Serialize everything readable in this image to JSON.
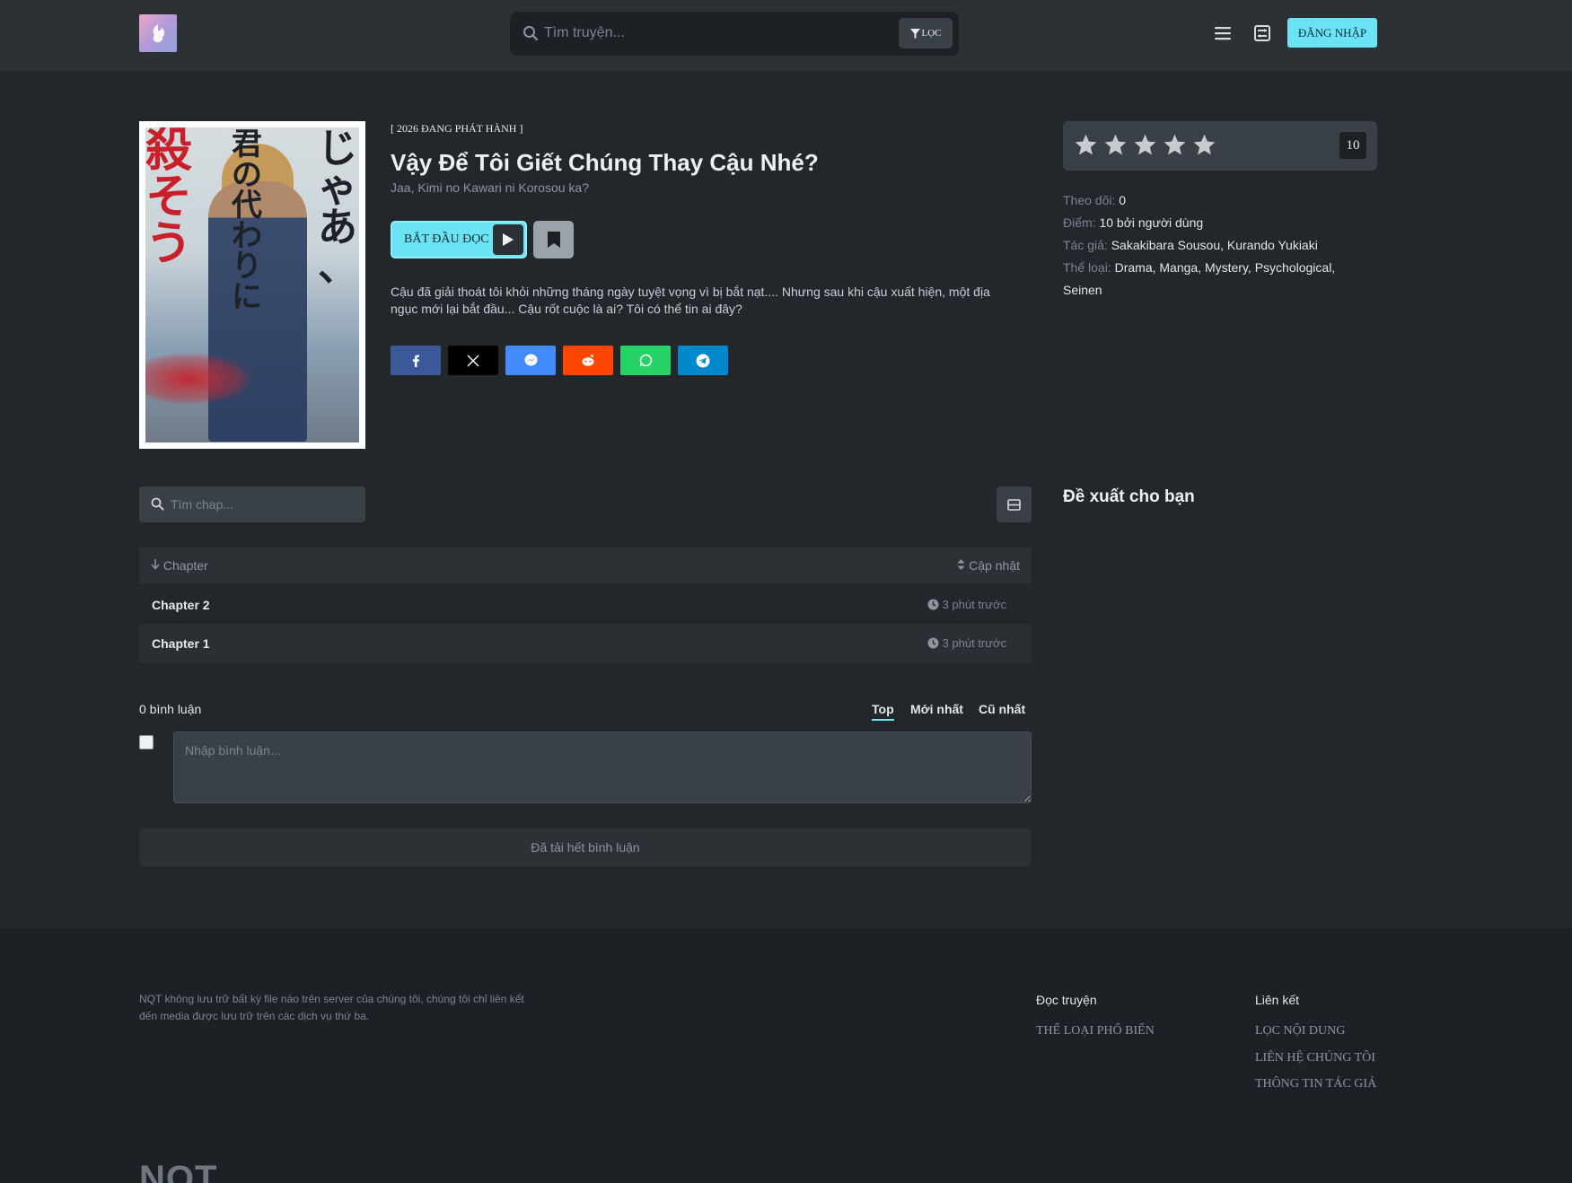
{
  "header": {
    "search_placeholder": "Tìm truyện...",
    "filter_label": "LỌC",
    "login_label": "ĐĂNG NHẬP"
  },
  "manga": {
    "status": "[ 2026 ĐANG PHÁT HÀNH ]",
    "title": "Vậy Để Tôi Giết Chúng Thay Cậu Nhé?",
    "alt_title": "Jaa, Kimi no Kawari ni Korosou ka?",
    "read_label": "BẮT ĐẦU ĐỌC",
    "description": "Cậu đã giải thoát tôi khỏi những tháng ngày tuyệt vọng vì bị bắt nạt.... Nhưng sau khi cậu xuất hiện, một địa ngục mới lại bắt đầu... Cậu rốt cuộc là ai? Tôi có thể tin ai đây?"
  },
  "share": [
    {
      "name": "facebook",
      "color": "#3b5998"
    },
    {
      "name": "x",
      "color": "#000000"
    },
    {
      "name": "messenger",
      "color": "#448aff"
    },
    {
      "name": "reddit",
      "color": "#ff4500"
    },
    {
      "name": "whatsapp",
      "color": "#25d366"
    },
    {
      "name": "telegram",
      "color": "#0088cc"
    }
  ],
  "rating": {
    "stars": 5,
    "value": "10"
  },
  "meta": {
    "follow_label": "Theo dõi:",
    "follow_value": "0",
    "score_label": "Điểm:",
    "score_value": "10 bởi người dùng",
    "author_label": "Tác giả:",
    "author_value": "Sakakibara Sousou, Kurando Yukiaki",
    "genre_label": "Thể loại:",
    "genre_value": "Drama, Manga, Mystery, Psychological,",
    "genre_value_2": "Seinen"
  },
  "recommend_title": "Đề xuất cho bạn",
  "chapters": {
    "search_placeholder": "Tìm chap...",
    "col_chapter": "Chapter",
    "col_updated": "Cập nhật",
    "rows": [
      {
        "name": "Chapter 2",
        "time": "3 phút trước"
      },
      {
        "name": "Chapter 1",
        "time": "3 phút trước"
      }
    ]
  },
  "comments": {
    "count": "0 bình luận",
    "tabs": [
      "Top",
      "Mới nhất",
      "Cũ nhất"
    ],
    "input_placeholder": "Nhập bình luận...",
    "loaded_label": "Đã tải hết bình luận"
  },
  "footer": {
    "disclaimer": "NQT không lưu trữ bất kỳ file nào trên server của chúng tôi, chúng tôi chỉ liên kết đến media được lưu trữ trên các dịch vụ thứ ba.",
    "col1_title": "Đọc truyện",
    "col1_links": [
      "THỂ LOẠI PHỔ BIẾN"
    ],
    "col2_title": "Liên kết",
    "col2_links": [
      "LỌC NỘI DUNG",
      "LIÊN HỆ CHÚNG TÔI",
      "THÔNG TIN TÁC GIẢ"
    ],
    "brand": "NQT"
  },
  "colors": {
    "accent": "#6ce3f4",
    "background": "#22272b",
    "header": "#2c3136",
    "footer": "#1d2125"
  }
}
